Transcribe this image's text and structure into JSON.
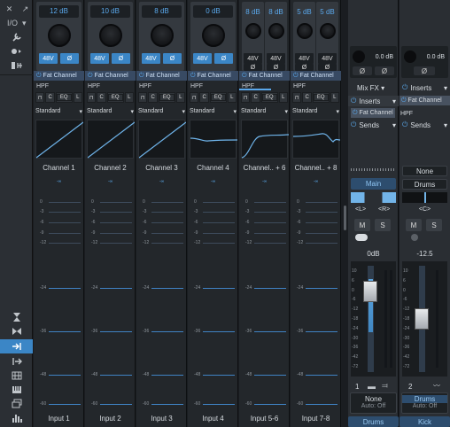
{
  "sidebar": {
    "close_glyph": "✕",
    "expand_glyph": "↗",
    "io_label": "I/O",
    "caret": "▾"
  },
  "channels": [
    {
      "gain": "12 dB",
      "name": "Channel 1",
      "input": "Input 1",
      "fx": "Fat Channel",
      "hpf": "HPF",
      "preset": "Standard",
      "phantom": "48V",
      "phase": "Ø",
      "eq": "EQ",
      "dual": false
    },
    {
      "gain": "10 dB",
      "name": "Channel 2",
      "input": "Input 2",
      "fx": "Fat Channel",
      "hpf": "HPF",
      "preset": "Standard",
      "phantom": "48V",
      "phase": "Ø",
      "eq": "EQ",
      "dual": false
    },
    {
      "gain": "8 dB",
      "name": "Channel 3",
      "input": "Input 3",
      "fx": "Fat Channel",
      "hpf": "HPF",
      "preset": "Standard",
      "phantom": "48V",
      "phase": "Ø",
      "eq": "EQ",
      "dual": false
    },
    {
      "gain": "0 dB",
      "name": "Channel 4",
      "input": "Input 4",
      "fx": "Fat Channel",
      "hpf": "HPF",
      "preset": "Standard",
      "phantom": "48V",
      "phase": "Ø",
      "eq": "EQ",
      "dual": false
    },
    {
      "gain": "8 dB",
      "gain2": "8 dB",
      "name": "Channel.. + 6",
      "input": "Input 5-6",
      "fx": "Fat Channel",
      "hpf": "HPF",
      "preset": "Standard",
      "phantom": "48V",
      "phase": "Ø",
      "eq": "EQ",
      "dual": true
    },
    {
      "gain": "5 dB",
      "gain2": "5 dB",
      "name": "Channel.. + 8",
      "input": "Input 7-8",
      "fx": "Fat Channel",
      "hpf": "HPF",
      "preset": "Standard",
      "phantom": "48V",
      "phase": "Ø",
      "eq": "EQ",
      "dual": true
    }
  ],
  "meter_ticks": [
    "0",
    "-3",
    "-6",
    "-9",
    "-12",
    "-24",
    "-36",
    "-48",
    "-60"
  ],
  "main_bus": {
    "gain": "0.0 dB",
    "phase": "Ø",
    "mixfx": "Mix FX",
    "inserts": "Inserts",
    "fat_channel": "Fat Channel",
    "sends": "Sends",
    "label": "Main",
    "left": "<L>",
    "right": "<R>",
    "mute": "M",
    "solo": "S",
    "level": "0dB",
    "num": "1",
    "route": "None",
    "auto": "Auto: Off",
    "bottom": "Drums",
    "fader_scale": [
      "10",
      "6",
      "0",
      "-6",
      "-12",
      "-18",
      "-24",
      "-30",
      "-36",
      "-42",
      "-72"
    ]
  },
  "kick_bus": {
    "gain": "0.0 dB",
    "phase": "Ø",
    "inserts": "Inserts",
    "fat_channel": "Fat Channel",
    "hpf": "HPF",
    "sends": "Sends",
    "none": "None",
    "drums": "Drums",
    "center": "<C>",
    "mute": "M",
    "solo": "S",
    "level": "-12.5",
    "num": "2",
    "route": "Drums",
    "auto": "Auto: Off",
    "bottom": "Kick",
    "fader_scale": [
      "10",
      "6",
      "0",
      "-6",
      "-12",
      "-18",
      "-24",
      "-30",
      "-36",
      "-42",
      "-72"
    ]
  },
  "colors": {
    "accent": "#3b86c6",
    "strip_bg": "#23272b",
    "meter_line": "#3f82c4"
  }
}
